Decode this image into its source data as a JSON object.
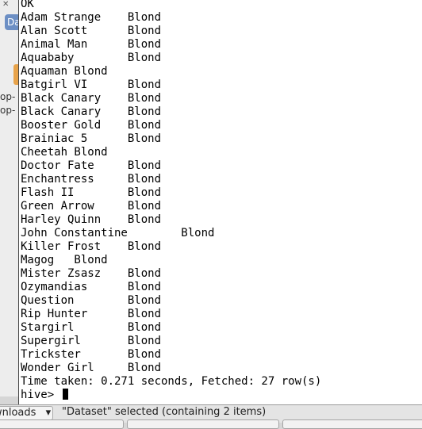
{
  "desktop": {
    "icon_label": "Da",
    "side_texts": [
      "op-",
      "op-"
    ]
  },
  "terminal": {
    "lines": [
      "OK",
      "Adam Strange    Blond",
      "Alan Scott      Blond",
      "Animal Man      Blond",
      "Aquababy        Blond",
      "Aquaman Blond",
      "Batgirl VI      Blond",
      "Black Canary    Blond",
      "Black Canary    Blond",
      "Booster Gold    Blond",
      "Brainiac 5      Blond",
      "Cheetah Blond",
      "Doctor Fate     Blond",
      "Enchantress     Blond",
      "Flash II        Blond",
      "Green Arrow     Blond",
      "Harley Quinn    Blond",
      "John Constantine        Blond",
      "Killer Frost    Blond",
      "Magog   Blond",
      "Mister Zsasz    Blond",
      "Ozymandias      Blond",
      "Question        Blond",
      "Rip Hunter      Blond",
      "Stargirl        Blond",
      "Supergirl       Blond",
      "Trickster       Blond",
      "Wonder Girl     Blond",
      "Time taken: 0.271 seconds, Fetched: 27 row(s)"
    ],
    "prompt": "hive> "
  },
  "taskbar": {
    "downloads_label": "wnloads",
    "dropdown_glyph": "▾",
    "status_text": "\"Dataset\" selected (containing 2 items)"
  }
}
